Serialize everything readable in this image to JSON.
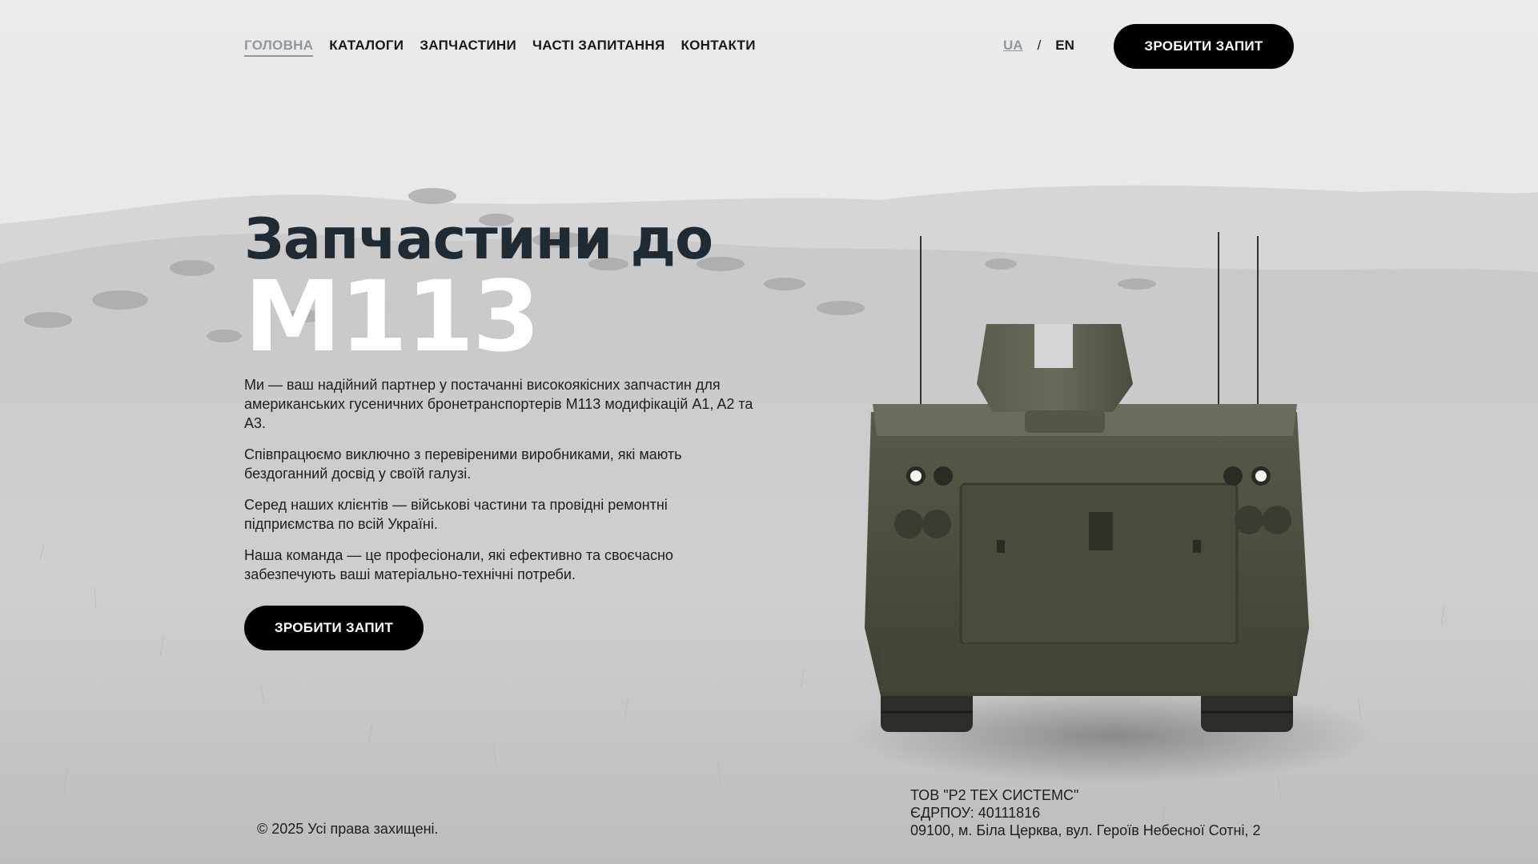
{
  "nav": {
    "items": [
      {
        "label": "ГОЛОВНА",
        "active": true
      },
      {
        "label": "КАТАЛОГИ",
        "active": false
      },
      {
        "label": "ЗАПЧАСТИНИ",
        "active": false
      },
      {
        "label": "ЧАСТІ ЗАПИТАННЯ",
        "active": false
      },
      {
        "label": "КОНТАКТИ",
        "active": false
      }
    ]
  },
  "lang": {
    "ua": "UA",
    "separator": "/",
    "en": "EN",
    "active": "UA"
  },
  "header": {
    "cta_label": "ЗРОБИТИ ЗАПИТ"
  },
  "hero": {
    "title": "Запчастини до",
    "model": "M113",
    "paragraphs": [
      "Ми — ваш надійний партнер у постачанні високоякісних запчастин для американських гусеничних бронетранспортерів M113 модифікацій A1, A2 та A3.",
      "Співпрацюємо виключно з перевіреними виробниками, які мають бездоганний досвід у своїй галузі.",
      "Серед наших клієнтів — військові частини та провідні ремонтні підприємства по всій Україні.",
      "Наша команда — це професіонали, які ефективно та своєчасно забезпечують ваші матеріально-технічні потреби."
    ],
    "cta_label": "ЗРОБИТИ ЗАПИТ"
  },
  "footer": {
    "copyright": "© 2025 Усі права захищені.",
    "company_name": "ТОВ \"Р2 ТЕХ СИСТЕМС\"",
    "edrpou": "ЄДРПОУ: 40111816",
    "address": "09100, м. Біла Церква, вул. Героїв Небесної Сотні, 2"
  },
  "colors": {
    "button_bg": "#000000",
    "nav_active": "#8f979f",
    "text": "#1c1f22",
    "vehicle_olive": "#4d4f40"
  },
  "icons": {
    "background": "grassland-landscape-image",
    "vehicle": "m113-armored-carrier-image"
  }
}
